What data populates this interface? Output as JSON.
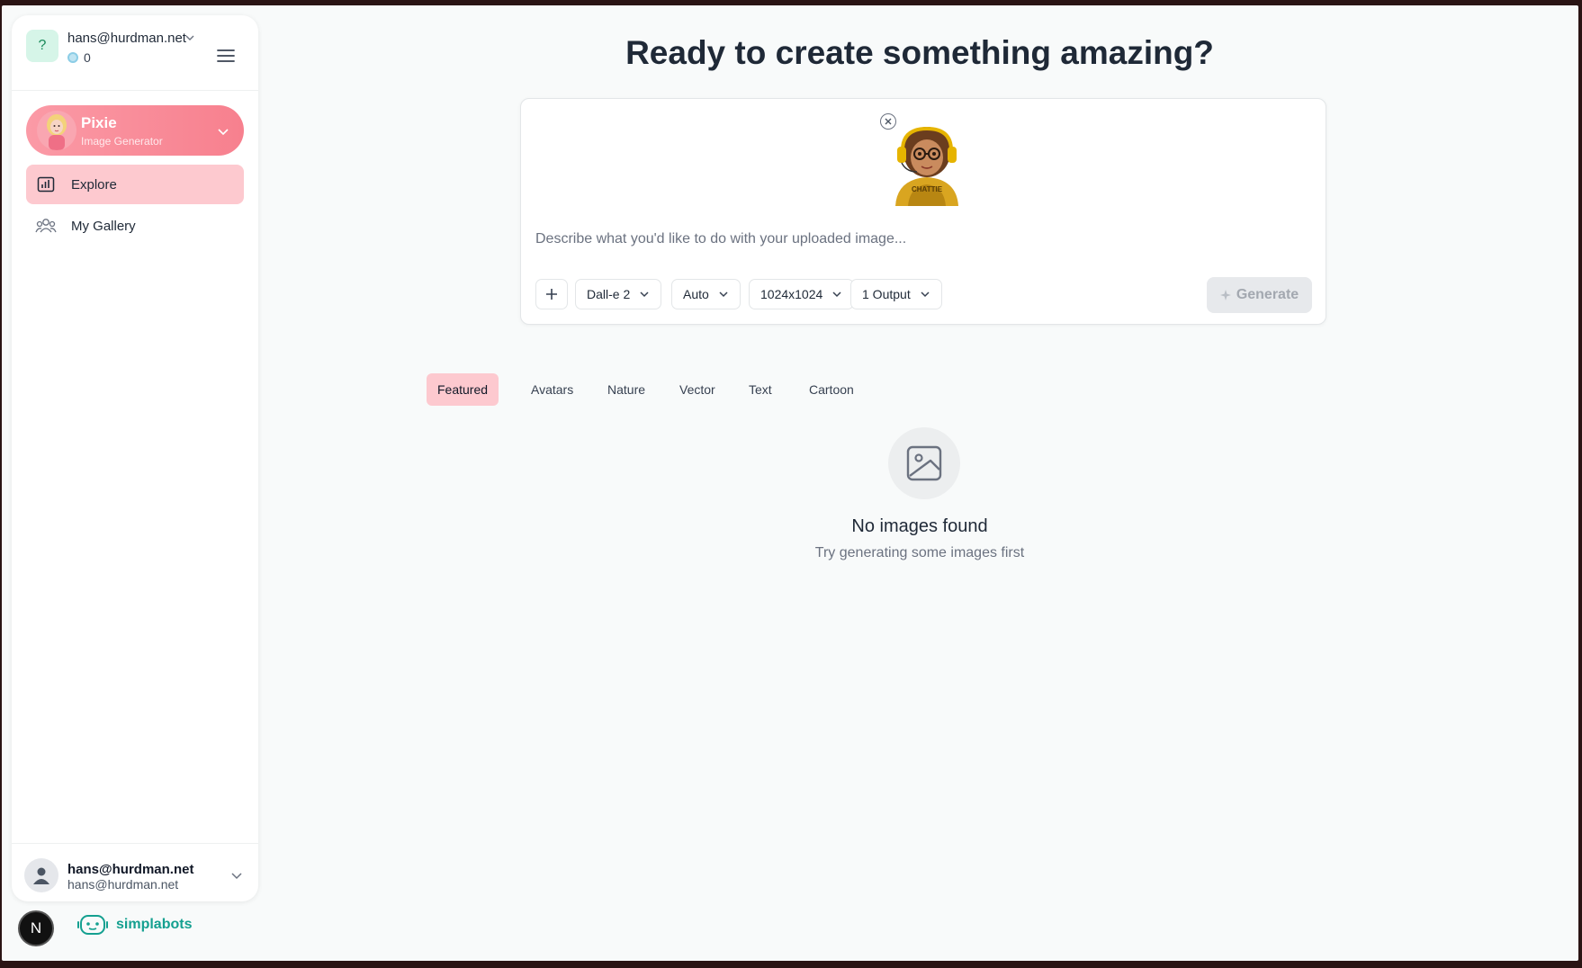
{
  "account": {
    "initial": "?",
    "email": "hans@hurdman.net",
    "credits": "0"
  },
  "bot": {
    "name": "Pixie",
    "subtitle": "Image Generator"
  },
  "nav": {
    "items": [
      {
        "label": "Explore",
        "active": true
      },
      {
        "label": "My Gallery",
        "active": false
      }
    ]
  },
  "user": {
    "name": "hans@hurdman.net",
    "email": "hans@hurdman.net"
  },
  "footer": {
    "badge": "N",
    "brand": "simplabots"
  },
  "main": {
    "title": "Ready to create something amazing?",
    "thumbnail_caption": "CHATTIE",
    "prompt_placeholder": "Describe what you'd like to do with your uploaded image...",
    "model": "Dall-e 2",
    "quality": "Auto",
    "size": "1024x1024",
    "outputs": "1 Output",
    "generate_label": "Generate"
  },
  "tabs": [
    {
      "label": "Featured",
      "active": true
    },
    {
      "label": "Avatars",
      "active": false
    },
    {
      "label": "Nature",
      "active": false
    },
    {
      "label": "Vector",
      "active": false
    },
    {
      "label": "Text",
      "active": false
    },
    {
      "label": "Cartoon",
      "active": false
    }
  ],
  "empty_state": {
    "title": "No images found",
    "subtitle": "Try generating some images first"
  },
  "colors": {
    "accent": "#fdc9cf",
    "bot_gradient_start": "#fb9aa6",
    "bot_gradient_end": "#f7808e",
    "brand": "#14a090"
  },
  "icons": {
    "menu": "hamburger-menu-icon",
    "explore": "bar-chart-icon",
    "gallery": "users-icon",
    "add": "plus-icon",
    "generate": "sparkle-icon",
    "empty": "image-icon"
  }
}
